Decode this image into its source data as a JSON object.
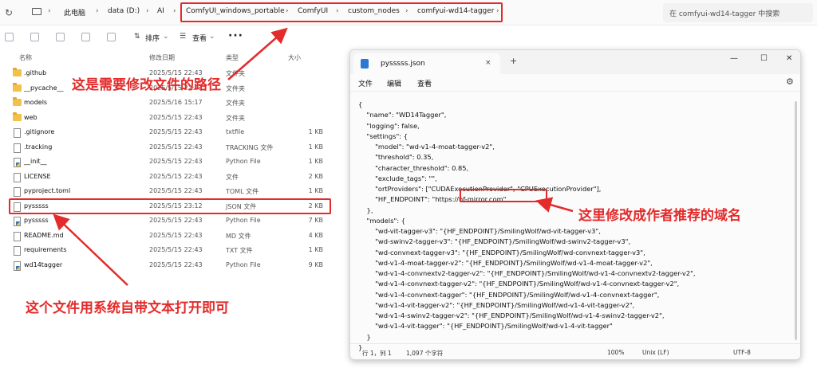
{
  "explorer": {
    "breadcrumb": [
      "此电脑",
      "data (D:)",
      "AI",
      "ComfyUI_windows_portable",
      "ComfyUI",
      "custom_nodes",
      "comfyui-wd14-tagger"
    ],
    "search_placeholder": "在 comfyui-wd14-tagger 中搜索",
    "toolbar": {
      "sort_label": "排序",
      "view_label": "查看",
      "more_label": "···"
    },
    "columns": {
      "name": "名称",
      "date": "修改日期",
      "type": "类型",
      "size": "大小"
    },
    "files": [
      {
        "name": ".github",
        "date": "2025/5/15 22:43",
        "type": "文件夹",
        "size": "",
        "icon": "folder-icon"
      },
      {
        "name": "__pycache__",
        "date": "2025/5/15 22:43",
        "type": "文件夹",
        "size": "",
        "icon": "folder-icon"
      },
      {
        "name": "models",
        "date": "2025/5/16 15:17",
        "type": "文件夹",
        "size": "",
        "icon": "folder-icon"
      },
      {
        "name": "web",
        "date": "2025/5/15 22:43",
        "type": "文件夹",
        "size": "",
        "icon": "folder-icon"
      },
      {
        "name": ".gitignore",
        "date": "2025/5/15 22:43",
        "type": "txtfile",
        "size": "1 KB",
        "icon": "document-icon"
      },
      {
        "name": ".tracking",
        "date": "2025/5/15 22:43",
        "type": "TRACKING 文件",
        "size": "1 KB",
        "icon": "document-icon"
      },
      {
        "name": "__init__",
        "date": "2025/5/15 22:43",
        "type": "Python File",
        "size": "1 KB",
        "icon": "python-icon"
      },
      {
        "name": "LICENSE",
        "date": "2025/5/15 22:43",
        "type": "文件",
        "size": "2 KB",
        "icon": "document-icon"
      },
      {
        "name": "pyproject.toml",
        "date": "2025/5/15 22:43",
        "type": "TOML 文件",
        "size": "1 KB",
        "icon": "document-icon"
      },
      {
        "name": "pysssss",
        "date": "2025/5/15 23:12",
        "type": "JSON 文件",
        "size": "2 KB",
        "icon": "document-icon"
      },
      {
        "name": "pysssss",
        "date": "2025/5/15 22:43",
        "type": "Python File",
        "size": "7 KB",
        "icon": "python-icon"
      },
      {
        "name": "README.md",
        "date": "2025/5/15 22:43",
        "type": "MD 文件",
        "size": "4 KB",
        "icon": "document-icon"
      },
      {
        "name": "requirements",
        "date": "2025/5/15 22:43",
        "type": "TXT 文件",
        "size": "1 KB",
        "icon": "document-icon"
      },
      {
        "name": "wd14tagger",
        "date": "2025/5/15 22:43",
        "type": "Python File",
        "size": "9 KB",
        "icon": "python-icon"
      }
    ]
  },
  "notepad": {
    "tab_title": "pysssss.json",
    "tab_close": "×",
    "new_tab": "+",
    "window_controls": {
      "minimize": "—",
      "maximize": "☐",
      "close": "✕"
    },
    "menu": [
      "文件",
      "编辑",
      "查看"
    ],
    "lines": [
      "{",
      "    \"name\": \"WD14Tagger\",",
      "    \"logging\": false,",
      "    \"settings\": {",
      "        \"model\": \"wd-v1-4-moat-tagger-v2\",",
      "        \"threshold\": 0.35,",
      "        \"character_threshold\": 0.85,",
      "        \"exclude_tags\": \"\",",
      "        \"ortProviders\": [\"CUDAExecutionProvider\", \"CPUExecutionProvider\"],",
      "        \"HF_ENDPOINT\": \"https://hf-mirror.com\"",
      "    },",
      "    \"models\": {",
      "        \"wd-vit-tagger-v3\": \"{HF_ENDPOINT}/SmilingWolf/wd-vit-tagger-v3\",",
      "        \"wd-swinv2-tagger-v3\": \"{HF_ENDPOINT}/SmilingWolf/wd-swinv2-tagger-v3\",",
      "        \"wd-convnext-tagger-v3\": \"{HF_ENDPOINT}/SmilingWolf/wd-convnext-tagger-v3\",",
      "        \"wd-v1-4-moat-tagger-v2\": \"{HF_ENDPOINT}/SmilingWolf/wd-v1-4-moat-tagger-v2\",",
      "        \"wd-v1-4-convnextv2-tagger-v2\": \"{HF_ENDPOINT}/SmilingWolf/wd-v1-4-convnextv2-tagger-v2\",",
      "        \"wd-v1-4-convnext-tagger-v2\": \"{HF_ENDPOINT}/SmilingWolf/wd-v1-4-convnext-tagger-v2\",",
      "        \"wd-v1-4-convnext-tagger\": \"{HF_ENDPOINT}/SmilingWolf/wd-v1-4-convnext-tagger\",",
      "        \"wd-v1-4-vit-tagger-v2\": \"{HF_ENDPOINT}/SmilingWolf/wd-v1-4-vit-tagger-v2\",",
      "        \"wd-v1-4-swinv2-tagger-v2\": \"{HF_ENDPOINT}/SmilingWolf/wd-v1-4-swinv2-tagger-v2\",",
      "        \"wd-v1-4-vit-tagger\": \"{HF_ENDPOINT}/SmilingWolf/wd-v1-4-vit-tagger\"",
      "    }",
      "}"
    ],
    "status": {
      "position": "行 1，列 1",
      "chars": "1,097 个字符",
      "zoom": "100%",
      "eol": "Unix (LF)",
      "encoding": "UTF-8"
    }
  },
  "annotations": {
    "path_note": "这是需要修改文件的路径",
    "domain_note": "这里修改成作者推荐的域名",
    "open_note": "这个文件用系统自带文本打开即可",
    "color": "#e32b2b"
  }
}
